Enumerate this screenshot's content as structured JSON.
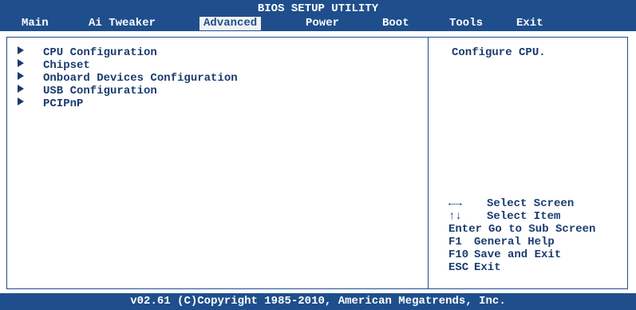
{
  "header": {
    "title": "BIOS SETUP UTILITY",
    "menu": [
      {
        "label": "Main",
        "selected": false
      },
      {
        "label": "Ai Tweaker",
        "selected": false
      },
      {
        "label": "Advanced",
        "selected": true
      },
      {
        "label": "Power",
        "selected": false
      },
      {
        "label": "Boot",
        "selected": false
      },
      {
        "label": "Tools",
        "selected": false
      },
      {
        "label": "Exit",
        "selected": false
      }
    ]
  },
  "main": {
    "items": [
      {
        "label": "CPU Configuration",
        "icon": "submenu-arrow-icon"
      },
      {
        "label": "Chipset",
        "icon": "submenu-arrow-icon"
      },
      {
        "label": "Onboard Devices Configuration",
        "icon": "submenu-arrow-icon"
      },
      {
        "label": "USB Configuration",
        "icon": "submenu-arrow-icon"
      },
      {
        "label": "PCIPnP",
        "icon": "submenu-arrow-icon"
      }
    ]
  },
  "help": {
    "text": "Configure CPU.",
    "keys": [
      {
        "key": "←→",
        "desc": "Select Screen"
      },
      {
        "key": "↑↓",
        "desc": "Select Item"
      },
      {
        "key": "Enter",
        "desc": "Go to Sub Screen"
      },
      {
        "key": "F1",
        "desc": "General Help"
      },
      {
        "key": "F10",
        "desc": "Save and Exit"
      },
      {
        "key": "ESC",
        "desc": "Exit"
      }
    ]
  },
  "footer": {
    "text": "v02.61 (C)Copyright 1985-2010, American Megatrends, Inc."
  },
  "colors": {
    "bar": "#1f4e8c",
    "text": "#1a3b6e",
    "selected_tab_bg": "#f2f2f2"
  }
}
